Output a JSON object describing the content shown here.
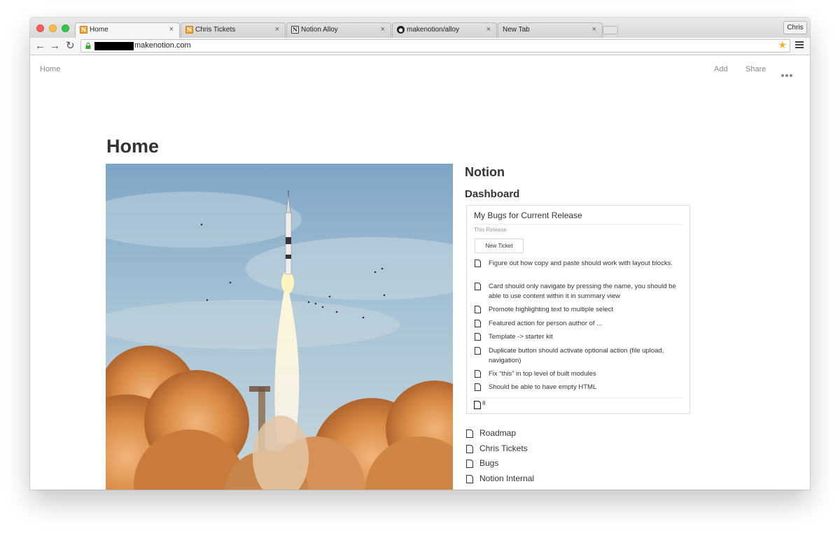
{
  "browser": {
    "tabs": [
      {
        "title": "Home",
        "icon": "notion-orange-icon"
      },
      {
        "title": "Chris Tickets",
        "icon": "notion-orange-icon"
      },
      {
        "title": "Notion Alloy",
        "icon": "notion-icon"
      },
      {
        "title": "makenotion/alloy",
        "icon": "github-icon"
      },
      {
        "title": "New Tab",
        "icon": ""
      }
    ],
    "tab_close": "×",
    "profile_name": "Chris",
    "url": "makenotion.com",
    "nav": {
      "back": "←",
      "forward": "→",
      "reload": "↻",
      "star": "★"
    }
  },
  "page": {
    "breadcrumb": "Home",
    "actions": {
      "add": "Add",
      "share": "Share"
    },
    "title": "Home",
    "side_heading": "Notion",
    "dashboard_heading": "Dashboard",
    "card": {
      "title": "My Bugs for Current Release",
      "subtitle": "This Release",
      "new_ticket_label": "New Ticket",
      "tickets": [
        "Figure out how copy and paste should work with layout blocks.",
        "Card should only navigate by pressing the name, you should be able to use content within it in summary view",
        "Promote highlighting text to multiple select",
        "Featured action for person author of ...",
        "Template -> starter kit",
        "Duplicate button should activate optional action (file upload, navigation)",
        "Fix “this” in top level of built modules",
        "Should be able to have empty HTML"
      ],
      "count": "8"
    },
    "links": [
      "Roadmap",
      "Chris Tickets",
      "Bugs",
      "Notion Internal"
    ]
  },
  "colors": {
    "sky": "#8fb3cf",
    "smoke": "#d98a45",
    "text": "#333333"
  }
}
